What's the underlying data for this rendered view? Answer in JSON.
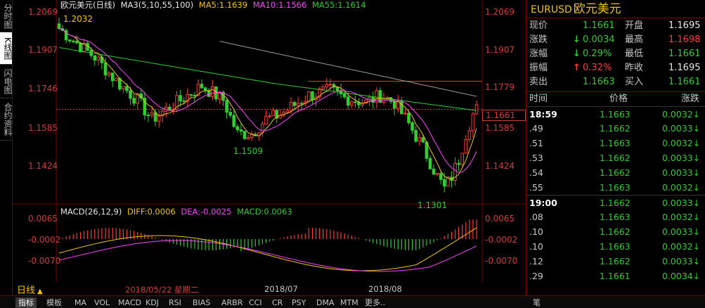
{
  "side_tabs": [
    "分时图",
    "K线图",
    "闪电图",
    "合约资料"
  ],
  "active_side_tab": 1,
  "legend": {
    "title": "欧元美元(日线)",
    "ma_params": "MA3(5,10,55,100)",
    "ma5": "MA5:1.1639",
    "ma10": "MA10:1.1566",
    "ma55": "MA55:1.1614"
  },
  "macd_legend": {
    "params": "MACD(26,12,9)",
    "diff": "DIFF:0.0006",
    "dea": "DEA:-0.0025",
    "macd": "MACD:0.0063"
  },
  "price_axis": [
    "1.2069",
    "1.1907",
    "1.1746",
    "1.1585",
    "1.1424"
  ],
  "macd_axis": [
    "0.0065",
    "-0.0002",
    "-0.0070"
  ],
  "annotations": {
    "high": "1.2032",
    "low1": "1.1509",
    "low2": "1.1301",
    "resistance": "1.1779",
    "current": "1.1661"
  },
  "x_axis": {
    "period_label": "日线",
    "cursor_date": "2018/05/22 星期二",
    "dates": [
      "2018/07",
      "2018/08"
    ]
  },
  "bottom_tabs": [
    "指标",
    "模板",
    "MA",
    "VOL",
    "MACD",
    "KDJ",
    "RSI",
    "BIAS",
    "ARBR",
    "CCI",
    "CR",
    "PSY",
    "DMA",
    "MTM",
    "更多..",
    "笔"
  ],
  "quote": {
    "code": "EURUSD",
    "name": "欧元美元",
    "rows": [
      {
        "l1": "现价",
        "v1": "1.1661",
        "c1": "green",
        "l2": "开盘",
        "v2": "1.1695",
        "c2": "white"
      },
      {
        "l1": "涨跌",
        "v1": "0.0034",
        "c1": "green",
        "arrow1": "down",
        "l2": "最高",
        "v2": "1.1698",
        "c2": "red"
      },
      {
        "l1": "涨幅",
        "v1": "0.29%",
        "c1": "green",
        "arrow1": "down",
        "l2": "最低",
        "v2": "1.1661",
        "c2": "green"
      },
      {
        "l1": "振幅",
        "v1": "0.32%",
        "c1": "red",
        "arrow1": "up",
        "l2": "昨收",
        "v2": "1.1695",
        "c2": "white"
      },
      {
        "l1": "卖出",
        "v1": "1.1663",
        "c1": "green",
        "l2": "买入",
        "v2": "1.1661",
        "c2": "green"
      }
    ]
  },
  "ticks_header": {
    "time": "时间",
    "price": "价格",
    "change": "涨跌"
  },
  "ticks": [
    {
      "t": "18:59",
      "p": "1.1663",
      "v": "0.0032"
    },
    {
      "t": ".49",
      "p": "1.1662",
      "v": "0.0033"
    },
    {
      "t": ".51",
      "p": "1.1663",
      "v": "0.0032"
    },
    {
      "t": ".53",
      "p": "1.1662",
      "v": "0.0033"
    },
    {
      "t": ".54",
      "p": "1.1662",
      "v": "0.0033"
    },
    {
      "t": ".55",
      "p": "1.1663",
      "v": "0.0032"
    },
    {
      "t": "19:00",
      "p": "1.1662",
      "v": "0.0033"
    },
    {
      "t": ".08",
      "p": "1.1663",
      "v": "0.0032"
    },
    {
      "t": ".10",
      "p": "1.1662",
      "v": "0.0033"
    },
    {
      "t": ".10",
      "p": "1.1663",
      "v": "0.0032"
    },
    {
      "t": ".12",
      "p": "1.1662",
      "v": "0.0033"
    },
    {
      "t": ".29",
      "p": "1.1661",
      "v": "0.0034"
    }
  ],
  "colors": {
    "up": "#ff3b3b",
    "down": "#33cc33",
    "ma5": "#ffffff",
    "ma10": "#f1c40f",
    "ma55": "#ff44ff",
    "ma100": "#33cc33",
    "ma_long": "#999999"
  }
}
